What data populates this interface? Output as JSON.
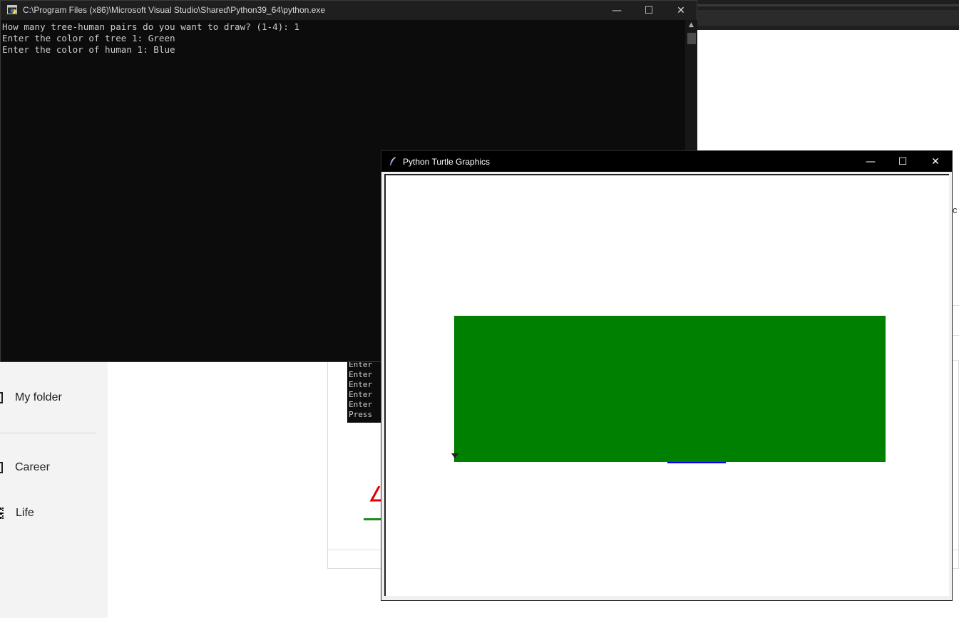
{
  "console": {
    "title": "C:\\Program Files (x86)\\Microsoft Visual Studio\\Shared\\Python39_64\\python.exe",
    "lines": [
      "How many tree-human pairs do you want to draw? (1-4): 1",
      "Enter the color of tree 1: Green",
      "Enter the color of human 1: Blue"
    ],
    "buttons": {
      "minimize": "—",
      "maximize": "☐",
      "close": "✕"
    }
  },
  "turtle": {
    "title": "Python Turtle Graphics",
    "buttons": {
      "minimize": "—",
      "maximize": "☐",
      "close": "✕"
    },
    "tree_color": "#008000",
    "human_color": "#0000ff"
  },
  "background": {
    "sidebar": {
      "items": [
        {
          "label": "My folder"
        },
        {
          "label": "Career"
        },
        {
          "label": "Life"
        }
      ]
    },
    "mini_console": {
      "lines": [
        "Enter",
        "Enter",
        "Enter",
        "Enter",
        "Enter",
        "Press"
      ]
    },
    "right_edge_char": "c"
  }
}
